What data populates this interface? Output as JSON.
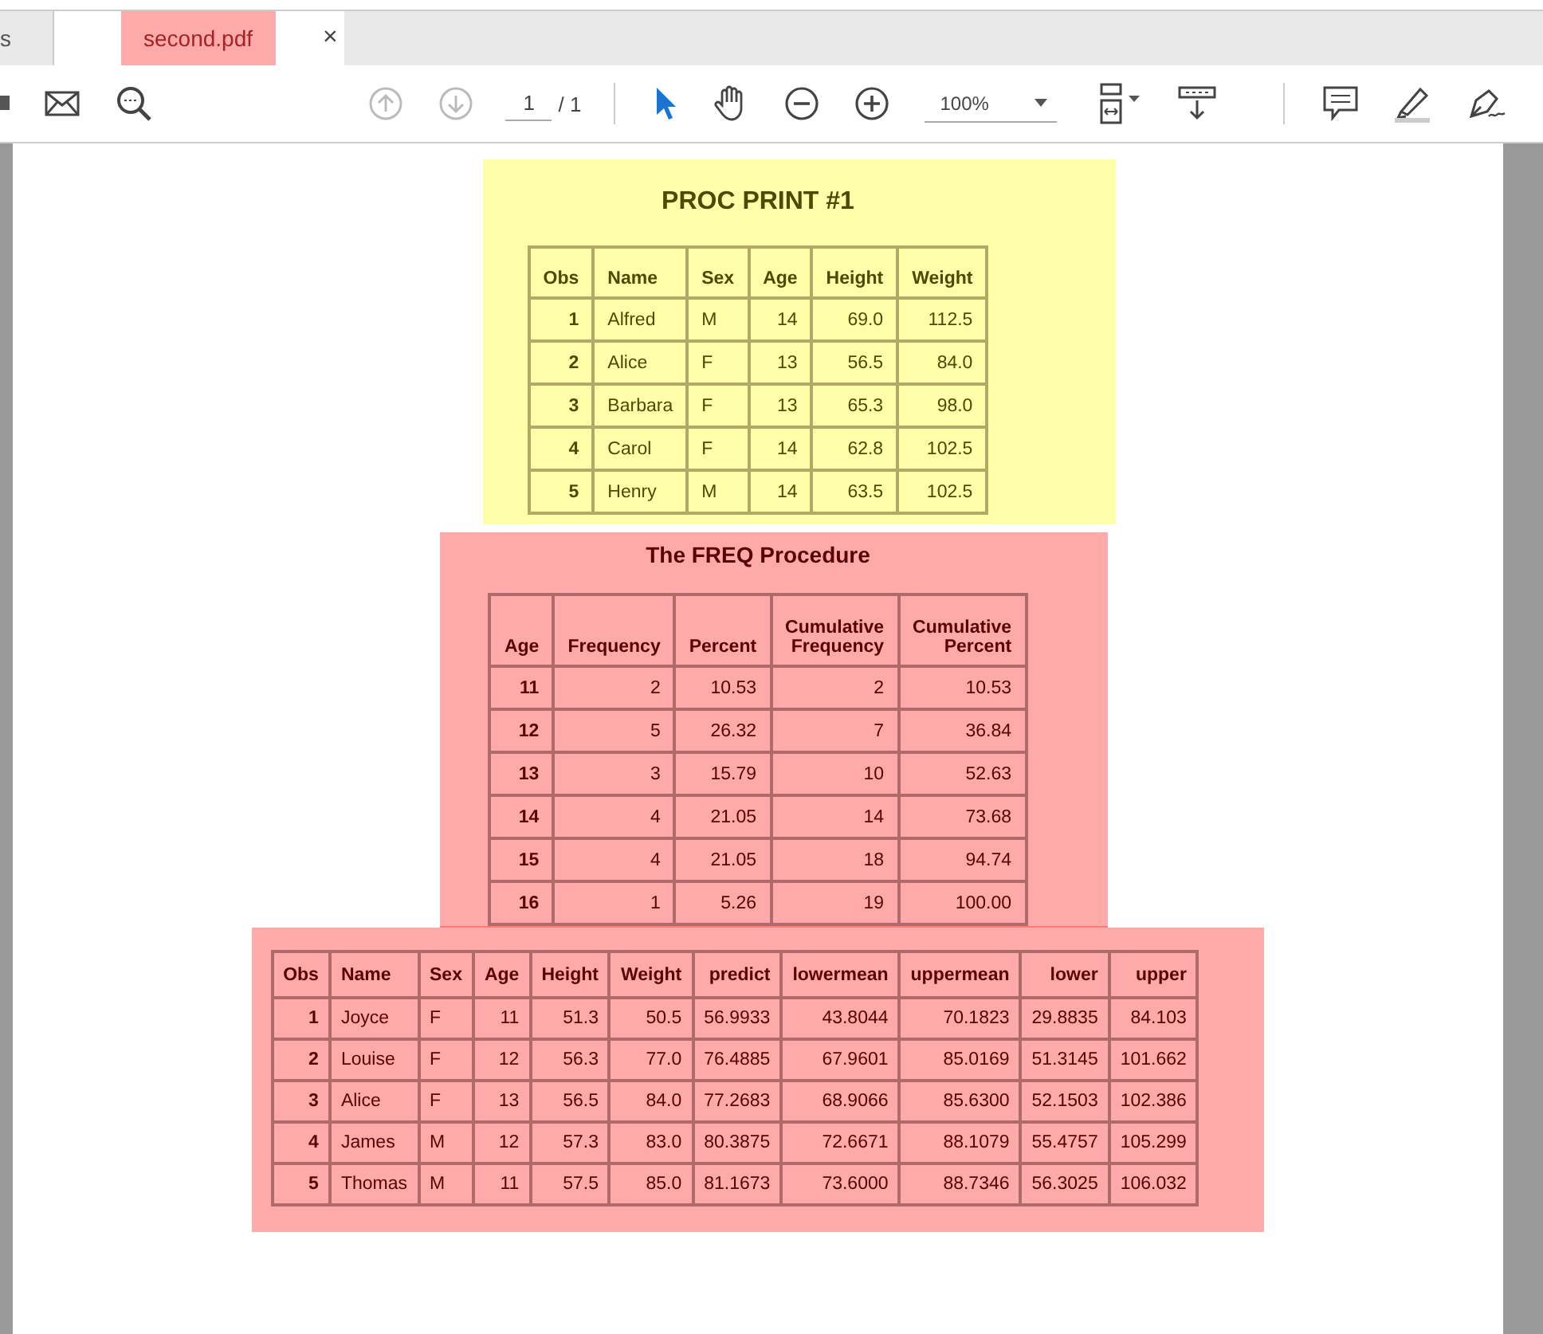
{
  "tabs": [
    {
      "label": "s",
      "selected": false
    },
    {
      "label": "second.pdf",
      "selected": true,
      "close": "×"
    }
  ],
  "toolbar": {
    "page_current": "1",
    "page_total": "/ 1",
    "zoom": "100%"
  },
  "panels": [
    {
      "color": "#ffffaa",
      "title": "PROC PRINT #1",
      "columns": [
        {
          "label": "Obs",
          "kind": "label"
        },
        {
          "label": "Name",
          "kind": "text"
        },
        {
          "label": "Sex",
          "kind": "text"
        },
        {
          "label": "Age",
          "kind": "number"
        },
        {
          "label": "Height",
          "kind": "number"
        },
        {
          "label": "Weight",
          "kind": "number"
        }
      ],
      "rows": [
        [
          "1",
          "Alfred",
          "M",
          "14",
          "69.0",
          "112.5"
        ],
        [
          "2",
          "Alice",
          "F",
          "13",
          "56.5",
          "84.0"
        ],
        [
          "3",
          "Barbara",
          "F",
          "13",
          "65.3",
          "98.0"
        ],
        [
          "4",
          "Carol",
          "F",
          "14",
          "62.8",
          "102.5"
        ],
        [
          "5",
          "Henry",
          "M",
          "14",
          "63.5",
          "102.5"
        ]
      ]
    },
    {
      "color": "#ffaaaa",
      "title": "The FREQ Procedure",
      "columns": [
        {
          "label": "Age",
          "kind": "label"
        },
        {
          "label": "Frequency",
          "kind": "number"
        },
        {
          "label": "Percent",
          "kind": "number"
        },
        {
          "label": "Cumulative\nFrequency",
          "kind": "number"
        },
        {
          "label": "Cumulative\nPercent",
          "kind": "number"
        }
      ],
      "rows": [
        [
          "11",
          "2",
          "10.53",
          "2",
          "10.53"
        ],
        [
          "12",
          "5",
          "26.32",
          "7",
          "36.84"
        ],
        [
          "13",
          "3",
          "15.79",
          "10",
          "52.63"
        ],
        [
          "14",
          "4",
          "21.05",
          "14",
          "73.68"
        ],
        [
          "15",
          "4",
          "21.05",
          "18",
          "94.74"
        ],
        [
          "16",
          "1",
          "5.26",
          "19",
          "100.00"
        ]
      ]
    },
    {
      "color": "#ffaaaa",
      "columns": [
        {
          "label": "Obs",
          "kind": "label"
        },
        {
          "label": "Name",
          "kind": "text"
        },
        {
          "label": "Sex",
          "kind": "text"
        },
        {
          "label": "Age",
          "kind": "number"
        },
        {
          "label": "Height",
          "kind": "number"
        },
        {
          "label": "Weight",
          "kind": "number"
        },
        {
          "label": "predict",
          "kind": "number"
        },
        {
          "label": "lowermean",
          "kind": "number"
        },
        {
          "label": "uppermean",
          "kind": "number"
        },
        {
          "label": "lower",
          "kind": "number"
        },
        {
          "label": "upper",
          "kind": "number"
        }
      ],
      "rows": [
        [
          "1",
          "Joyce",
          "F",
          "11",
          "51.3",
          "50.5",
          "56.9933",
          "43.8044",
          "70.1823",
          "29.8835",
          "84.103"
        ],
        [
          "2",
          "Louise",
          "F",
          "12",
          "56.3",
          "77.0",
          "76.4885",
          "67.9601",
          "85.0169",
          "51.3145",
          "101.662"
        ],
        [
          "3",
          "Alice",
          "F",
          "13",
          "56.5",
          "84.0",
          "77.2683",
          "68.9066",
          "85.6300",
          "52.1503",
          "102.386"
        ],
        [
          "4",
          "James",
          "M",
          "12",
          "57.3",
          "83.0",
          "80.3875",
          "72.6671",
          "88.1079",
          "55.4757",
          "105.299"
        ],
        [
          "5",
          "Thomas",
          "M",
          "11",
          "57.5",
          "85.0",
          "81.1673",
          "73.6000",
          "88.7346",
          "56.3025",
          "106.032"
        ]
      ]
    }
  ]
}
